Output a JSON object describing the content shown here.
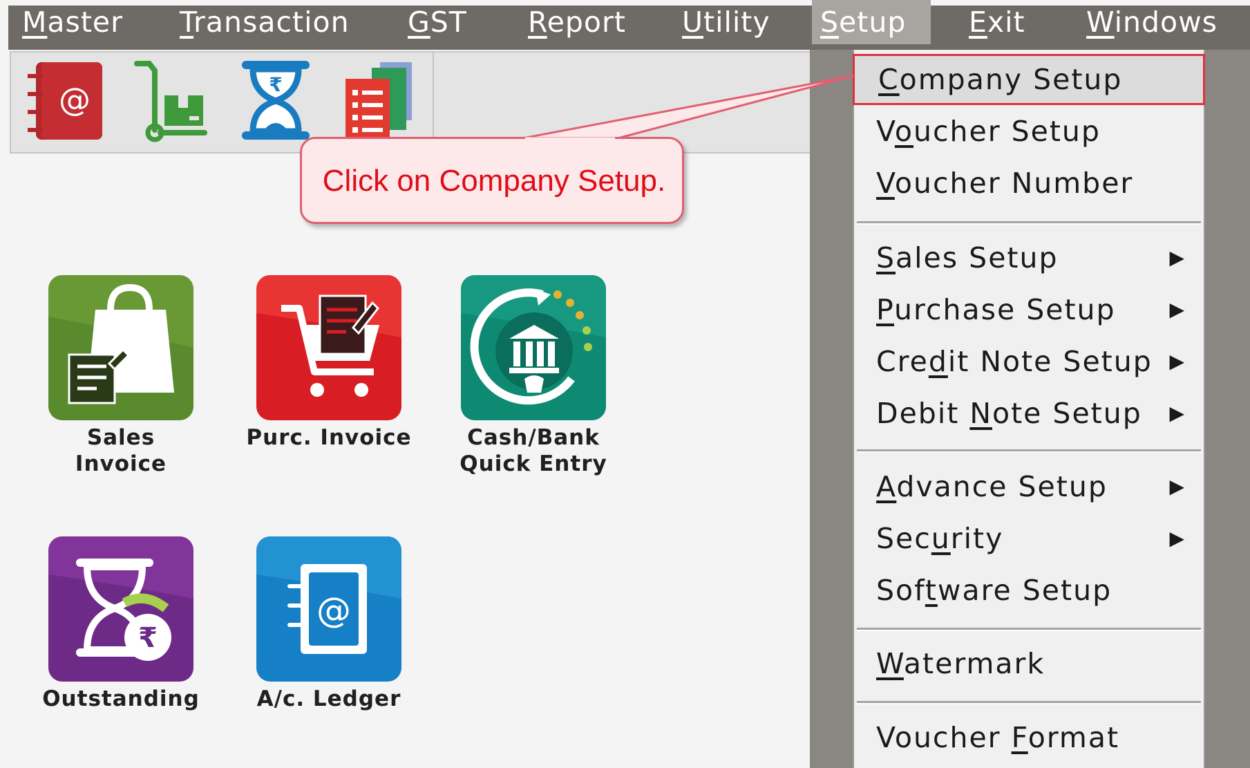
{
  "menubar": {
    "items": [
      {
        "label": "Master",
        "key": "M"
      },
      {
        "label": "Transaction",
        "key": "T"
      },
      {
        "label": "GST",
        "key": "G"
      },
      {
        "label": "Report",
        "key": "R"
      },
      {
        "label": "Utility",
        "key": "U"
      },
      {
        "label": "Setup",
        "key": "S",
        "active": true
      },
      {
        "label": "Exit",
        "key": "E"
      },
      {
        "label": "Windows",
        "key": "W"
      }
    ]
  },
  "toolbar": {
    "icons": [
      "address-book-icon",
      "hand-truck-icon",
      "hourglass-rupee-icon",
      "documents-stack-icon"
    ]
  },
  "tiles": [
    {
      "label": "Sales\nInvoice",
      "icon": "shopping-bag-icon",
      "color": "#5a8a2e"
    },
    {
      "label": "Purc. Invoice",
      "icon": "shopping-cart-icon",
      "color": "#d81e24"
    },
    {
      "label": "Cash/Bank\nQuick Entry",
      "icon": "bank-icon",
      "color": "#0f8a72"
    },
    {
      "label": "Outstanding",
      "icon": "hourglass-icon",
      "color": "#6d2a86"
    },
    {
      "label": "A/c. Ledger",
      "icon": "address-book-icon",
      "color": "#1580c6"
    }
  ],
  "dropdown": {
    "items": [
      {
        "label": "Company Setup",
        "key": "C",
        "highlight": true
      },
      {
        "label": "Voucher Setup",
        "key": "o"
      },
      {
        "label": "Voucher Number",
        "key": "V"
      },
      {
        "label": "Sales Setup",
        "key": "S",
        "submenu": true
      },
      {
        "label": "Purchase Setup",
        "key": "P",
        "submenu": true
      },
      {
        "label": "Credit Note Setup",
        "key": "d",
        "submenu": true
      },
      {
        "label": "Debit Note Setup",
        "key": "N",
        "submenu": true
      },
      {
        "label": "Advance Setup",
        "key": "A",
        "submenu": true
      },
      {
        "label": "Security",
        "key": "u",
        "submenu": true
      },
      {
        "label": "Software Setup",
        "key": "t"
      },
      {
        "label": "Watermark",
        "key": "W"
      },
      {
        "label": "Voucher Format",
        "key": "F"
      }
    ]
  },
  "callout": {
    "text": "Click on Company Setup."
  },
  "colors": {
    "menubar": "#6e6a65",
    "highlight_border": "#e03040",
    "callout_text": "#e00c18"
  }
}
